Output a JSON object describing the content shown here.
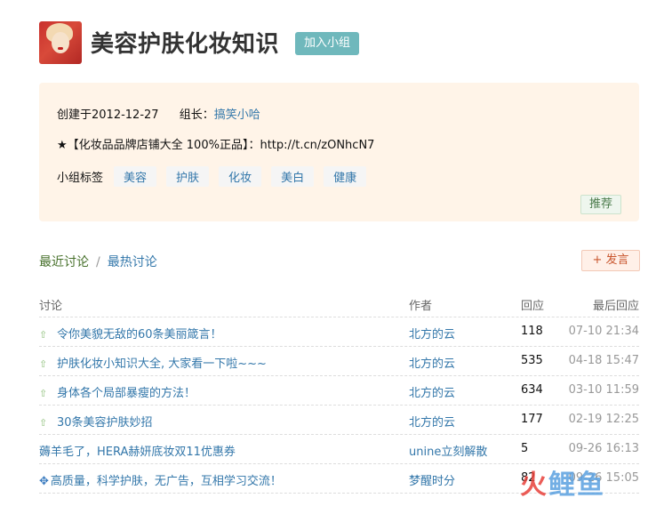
{
  "header": {
    "title": "美容护肤化妆知识",
    "join_label": "加入小组"
  },
  "info": {
    "created": "创建于2012-12-27",
    "leader_label": "组长：",
    "leader_name": "搞笑小哈",
    "promo": "★【化妆品品牌店铺大全 100%正品】：http://t.cn/zONhcN7",
    "tags_label": "小组标签",
    "tags": [
      "美容",
      "护肤",
      "化妆",
      "美白",
      "健康"
    ],
    "recommend_label": "推荐"
  },
  "tabs": {
    "recent": "最近讨论",
    "separator": "/",
    "hot": "最热讨论",
    "post_label": "+ 发言"
  },
  "table": {
    "headers": [
      "讨论",
      "作者",
      "回应",
      "最后回应"
    ],
    "rows": [
      {
        "icon": "up-arrow-icon",
        "title": "令你美貌无敌的60条美丽箴言！",
        "author": "北方的云",
        "replies": "118",
        "last": "07-10 21:34"
      },
      {
        "icon": "up-arrow-icon",
        "title": "护肤化妆小知识大全, 大家看一下啦~~~",
        "author": "北方的云",
        "replies": "535",
        "last": "04-18 15:47"
      },
      {
        "icon": "up-arrow-icon",
        "title": "身体各个局部暴瘦的方法！",
        "author": "北方的云",
        "replies": "634",
        "last": "03-10 11:59"
      },
      {
        "icon": "up-arrow-icon",
        "title": "30条美容护肤妙招",
        "author": "北方的云",
        "replies": "177",
        "last": "02-19 12:25"
      },
      {
        "icon": "",
        "title": "薅羊毛了，HERA赫妍底妆双11优惠券",
        "author": "unine立刻解散",
        "replies": "5",
        "last": "09-26 16:13"
      },
      {
        "icon": "pin-icon",
        "title": "高质量，科学护肤，无广告，互相学习交流！",
        "author": "梦醒时分",
        "replies": "82",
        "last": "09-26 15:05"
      }
    ]
  },
  "watermark": {
    "part1": "火",
    "part2": "鲤鱼"
  }
}
